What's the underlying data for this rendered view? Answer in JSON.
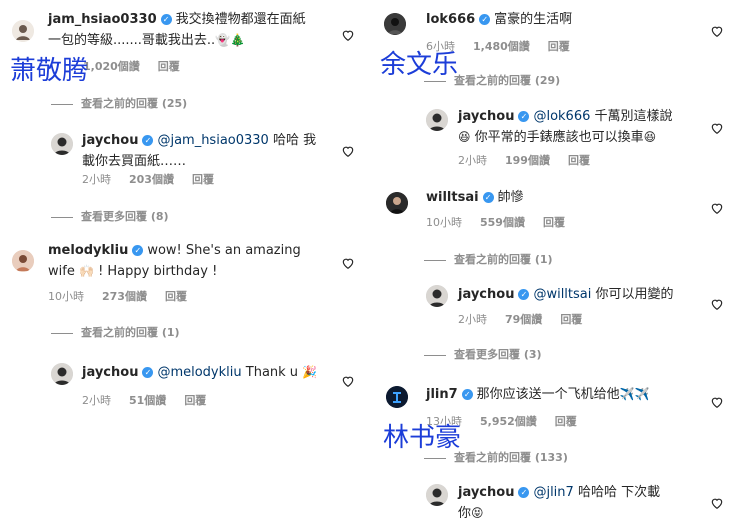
{
  "left": {
    "c1": {
      "username": "jam_hsiao0330",
      "text_line1": "我交換禮物都還在面紙",
      "text_line2": "一包的等級.......哥載我出去..",
      "emoji": "👻🎄",
      "likes": "1,020個讚",
      "reply": "回覆"
    },
    "c1_thread": "查看之前的回覆 (25)",
    "c2": {
      "username": "jaychou",
      "mention": "@jam_hsiao0330",
      "text_line1": " 哈哈 我",
      "text_line2": "載你去買面紙……",
      "time": "2小時",
      "likes": "203個讚",
      "reply": "回覆"
    },
    "c2_thread": "查看更多回覆 (8)",
    "c3": {
      "username": "melodykliu",
      "text_line1": "wow! She's an amazing",
      "text_line2a": "wife",
      "emoji": "🙌🏻",
      "text_line2b": "! Happy birthday !",
      "time": "10小時",
      "likes": "273個讚",
      "reply": "回覆"
    },
    "c3_thread": "查看之前的回覆 (1)",
    "c4": {
      "username": "jaychou",
      "mention": "@melodykliu",
      "text": " Thank u",
      "emoji": "🎉",
      "time": "2小時",
      "likes": "51個讚",
      "reply": "回覆"
    }
  },
  "right": {
    "c1": {
      "username": "lok666",
      "text": "富豪的生活啊",
      "time": "6小時",
      "likes": "1,480個讚",
      "reply": "回覆"
    },
    "c1_thread": "查看之前的回覆 (29)",
    "c2": {
      "username": "jaychou",
      "mention": "@lok666",
      "text_line1": " 千萬別這樣說",
      "emoji1": "😆",
      "text_line2": " 你平常的手錶應該也可以換車",
      "emoji2": "😆",
      "time": "2小時",
      "likes": "199個讚",
      "reply": "回覆"
    },
    "c3": {
      "username": "willtsai",
      "text": "帥慘",
      "time": "10小時",
      "likes": "559個讚",
      "reply": "回覆"
    },
    "c3_thread": "查看之前的回覆 (1)",
    "c4": {
      "username": "jaychou",
      "mention": "@willtsai",
      "text": " 你可以用變的",
      "time": "2小時",
      "likes": "79個讚",
      "reply": "回覆"
    },
    "c4_thread": "查看更多回覆 (3)",
    "c5": {
      "username": "jlin7",
      "text": "那你应该送一个飞机给他",
      "emoji": "✈️✈️",
      "time": "13小時",
      "likes": "5,952個讚",
      "reply": "回覆"
    },
    "c5_thread": "查看之前的回覆 (133)",
    "c6": {
      "username": "jaychou",
      "mention": "@jlin7",
      "text_line1": " 哈哈哈 下次載",
      "text_line2": "你",
      "emoji": "😝"
    }
  },
  "overlays": {
    "name1": "萧敬腾",
    "name2": "余文乐",
    "name3": "林书豪"
  },
  "colors": {
    "verified": "#3897f0",
    "overlay_text": "#1c3dd8",
    "meta": "#8e8e8e",
    "mention": "#00376b"
  }
}
